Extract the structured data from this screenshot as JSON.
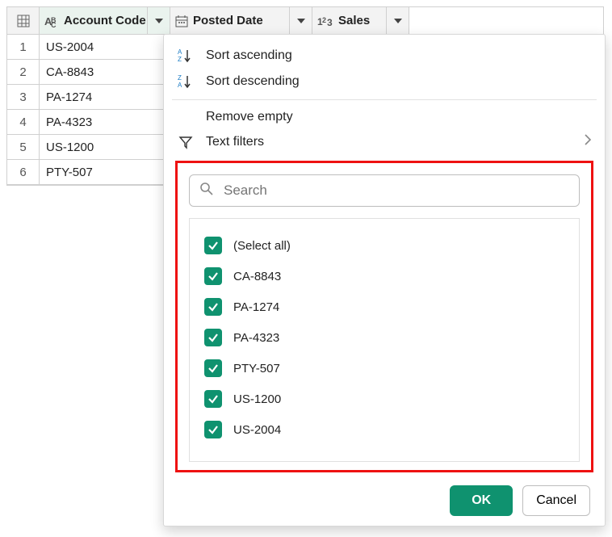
{
  "columns": [
    {
      "name": "Account Code",
      "type": "text"
    },
    {
      "name": "Posted Date",
      "type": "date"
    },
    {
      "name": "Sales",
      "type": "number"
    }
  ],
  "rows": [
    {
      "n": "1",
      "c0": "US-2004"
    },
    {
      "n": "2",
      "c0": "CA-8843"
    },
    {
      "n": "3",
      "c0": "PA-1274"
    },
    {
      "n": "4",
      "c0": "PA-4323"
    },
    {
      "n": "5",
      "c0": "US-1200"
    },
    {
      "n": "6",
      "c0": "PTY-507"
    }
  ],
  "menu": {
    "sort_asc": "Sort ascending",
    "sort_desc": "Sort descending",
    "remove_empty": "Remove empty",
    "text_filters": "Text filters"
  },
  "search_placeholder": "Search",
  "filter_values": [
    "(Select all)",
    "CA-8843",
    "PA-1274",
    "PA-4323",
    "PTY-507",
    "US-1200",
    "US-2004"
  ],
  "buttons": {
    "ok": "OK",
    "cancel": "Cancel"
  }
}
